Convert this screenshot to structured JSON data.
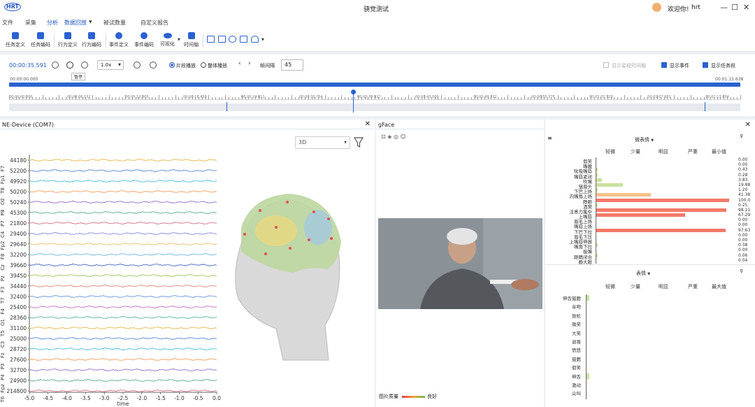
{
  "app": {
    "logo": "HRT",
    "title": "骁觉测试",
    "welcome": "欢迎你!",
    "user": "hrt",
    "window_controls": [
      "—",
      "☐",
      "✕"
    ]
  },
  "menu": {
    "items": [
      "文件",
      "采集",
      "分析",
      "数据回放",
      "被试数量",
      "自定义报告"
    ]
  },
  "toolbar": {
    "items": [
      "任务定义",
      "任务编码",
      "行为定义",
      "行为编码",
      "事件定义",
      "事件编码",
      "可视化",
      "时间轴"
    ]
  },
  "playback": {
    "current_time": "00:00:35.591",
    "pause_tooltip": "暂停",
    "speed": "1.0x",
    "mode_options": [
      "片段播放",
      "整体播放"
    ],
    "mode_selected": "片段播放",
    "frame_interval_label": "帧间隔",
    "frame_interval": "45",
    "checkboxes": [
      {
        "label": "显示星程时间轴",
        "checked": false
      },
      {
        "label": "显示事件",
        "checked": true
      },
      {
        "label": "显示任务段",
        "checked": true
      }
    ],
    "start_time": "00:00:00.000",
    "end_time": "00:01:15.638",
    "ticks": [
      "00:00:00.000",
      "00:00:06.152",
      "00:00:12.305",
      "00:00:18.458",
      "00:00:24.611",
      "00:00:30.764",
      "00:00:36.917",
      "00:00:43.069",
      "00:00:49.222",
      "00:00:55.375",
      "00:01:01.528",
      "00:01:07.681",
      "00:01:13.834"
    ],
    "progress_fraction": 0.47
  },
  "eeg": {
    "title": "NE-Device (COM7)",
    "view_select": "3D",
    "channels": [
      "F7",
      "Fp1",
      "T8",
      "O2",
      "P8",
      "P7",
      "C4",
      "Fp2",
      "F8",
      "Cz",
      "Pz",
      "F3",
      "T7",
      "F4",
      "O1",
      "T5",
      "C3",
      "Fz",
      "P3",
      "P4",
      "Fpz",
      "T6"
    ],
    "ylabels": [
      "44180",
      "52200",
      "49920",
      "50200",
      "50240",
      "45300",
      "21800",
      "29400",
      "29640",
      "32200",
      "39660",
      "39450",
      "34440",
      "32400",
      "25400",
      "28360",
      "31100",
      "25000",
      "28720",
      "27600",
      "32700",
      "24900",
      "214800"
    ],
    "xticks": [
      "-5.0",
      "-4.5",
      "-4.0",
      "-3.5",
      "-3.0",
      "-2.5",
      "-2.0",
      "-1.5",
      "-1.0",
      "-0.5",
      "0.0"
    ],
    "xlabel": "time",
    "colors": [
      "#e6b84a",
      "#5a8ad8",
      "#4ac0d8",
      "#f0a060",
      "#9870c8",
      "#5ab08a",
      "#d8708a",
      "#8a8ae0",
      "#e8c068",
      "#70b8e0",
      "#4a68c8",
      "#a0c860",
      "#e08878",
      "#6a98d8",
      "#c870c0",
      "#58b8a0"
    ]
  },
  "gface": {
    "title": "gFace",
    "quality_label": "图片质量",
    "quality_good": "良好",
    "micro": {
      "dropdown": "微表情",
      "headers": [
        "轻微",
        "少量",
        "明显",
        "严重",
        "最小值"
      ],
      "rows": [
        {
          "label": "假笑",
          "value": "0.00",
          "level": 0
        },
        {
          "label": "嘴撇",
          "value": "0.00",
          "level": 0
        },
        {
          "label": "吮吸嘴唇",
          "value": "0.43",
          "level": 0.005
        },
        {
          "label": "嘴唇紧闭",
          "value": "0.28",
          "level": 0.003
        },
        {
          "label": "吹嘴",
          "value": "3.83",
          "level": 0.04
        },
        {
          "label": "皱眉头",
          "value": "19.88",
          "level": 0.2
        },
        {
          "label": "下巴上扬",
          "value": "1.20",
          "level": 0.012
        },
        {
          "label": "内嘴角上扬",
          "value": "41.38",
          "level": 0.41
        },
        {
          "label": "睁眼",
          "value": "100.0",
          "level": 1.0
        },
        {
          "label": "酒窝",
          "value": "0.25",
          "level": 0.003
        },
        {
          "label": "注意力集中",
          "value": "98.11",
          "level": 0.98
        },
        {
          "label": "上嘴唇",
          "value": "67.29",
          "level": 0.67
        },
        {
          "label": "眉毛上扬",
          "value": "0.00",
          "level": 0
        },
        {
          "label": "嘴唇上扬",
          "value": "0.00",
          "level": 0
        },
        {
          "label": "下巴下拉",
          "value": "97.63",
          "level": 0.976
        },
        {
          "label": "眉毛下压",
          "value": "0.00",
          "level": 0
        },
        {
          "label": "上嘴唇伸展",
          "value": "0.00",
          "level": 0
        },
        {
          "label": "嘴角下拉",
          "value": "0.38",
          "level": 0.004
        },
        {
          "label": "拔嘴",
          "value": "0.00",
          "level": 0
        },
        {
          "label": "眼睛闭合",
          "value": "0.06",
          "level": 0.001
        },
        {
          "label": "静大眼",
          "value": "0.04",
          "level": 0
        }
      ]
    },
    "expression": {
      "dropdown": "表情",
      "headers": [
        "轻微",
        "少量",
        "明显",
        "严重",
        "最大值"
      ],
      "rows": [
        "伸舌鼓腮",
        "亲吻",
        "放松",
        "微笑",
        "大笑",
        "退畏",
        "愤怒",
        "鼓腮",
        "假笑",
        "伸舌",
        "激动",
        "尖叫"
      ]
    }
  }
}
